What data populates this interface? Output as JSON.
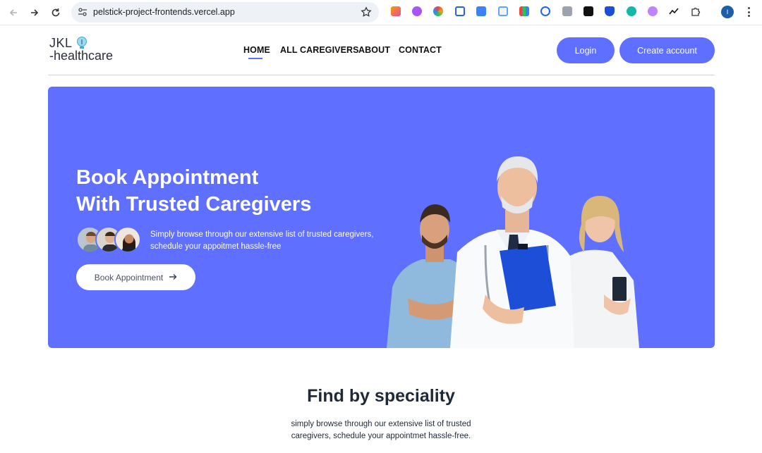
{
  "browser": {
    "url": "pelstick-project-frontends.vercel.app",
    "profile_initial": "I",
    "icons": [
      "back-icon",
      "forward-icon",
      "reload-icon",
      "site-settings-icon",
      "bookmark-star-icon",
      "extensions-puzzle-icon",
      "menu-dots-icon"
    ]
  },
  "site": {
    "logo_line1": "JKL",
    "logo_line2": "-healthcare",
    "nav": [
      "HOME",
      "ALL CAREGIVERS",
      "ABOUT",
      "CONTACT"
    ],
    "active_nav": "HOME",
    "login_label": "Login",
    "create_account_label": "Create account"
  },
  "hero": {
    "title_line1": "Book Appointment",
    "title_line2": "With Trusted Caregivers",
    "subtitle_line1": "Simply browse through our extensive list of trusted caregivers,",
    "subtitle_line2": "schedule your appoitmet hassle-free",
    "button_label": "Book Appointment",
    "button_icon": "arrow-right-icon"
  },
  "speciality": {
    "title": "Find by speciality",
    "subtitle_line1": "simply browse through our extensive list of trusted",
    "subtitle_line2": "caregivers, schedule your appointmet hassle-free."
  },
  "colors": {
    "accent": "#5f6fff",
    "text": "#1f2937"
  }
}
